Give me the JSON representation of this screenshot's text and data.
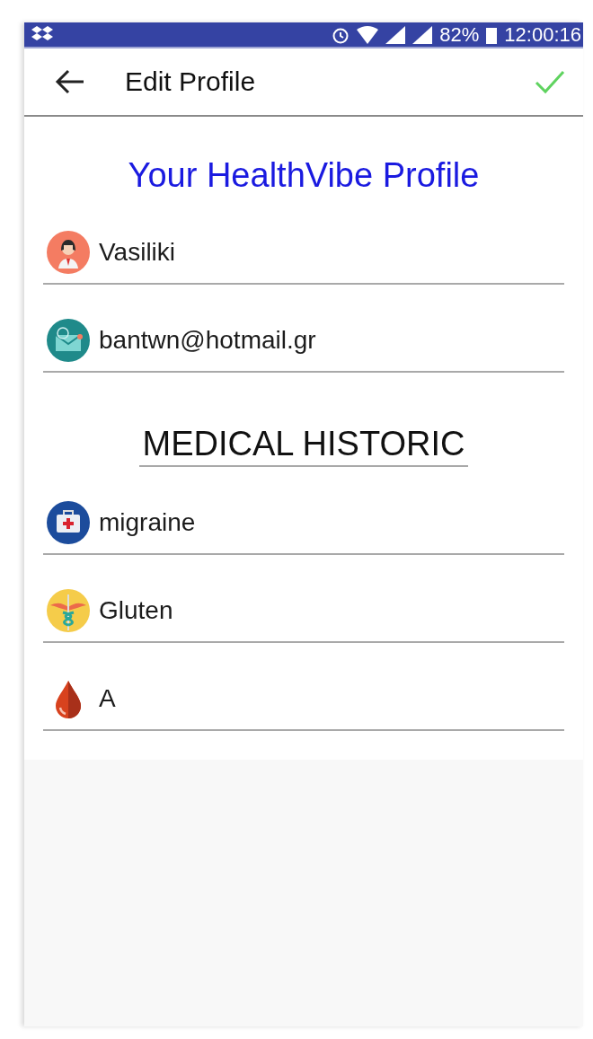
{
  "status_bar": {
    "battery": "82%",
    "time": "12:00:16"
  },
  "app_bar": {
    "title": "Edit Profile"
  },
  "heading": "Your HealthVibe Profile",
  "profile_fields": [
    {
      "kind": "person",
      "value": "Vasiliki"
    },
    {
      "kind": "email",
      "value": "bantwn@hotmail.gr"
    }
  ],
  "section_title": "MEDICAL HISTORIC",
  "medical_fields": [
    {
      "kind": "medkit",
      "value": "migraine"
    },
    {
      "kind": "caduceus",
      "value": "Gluten"
    },
    {
      "kind": "blood",
      "value": "A"
    }
  ]
}
